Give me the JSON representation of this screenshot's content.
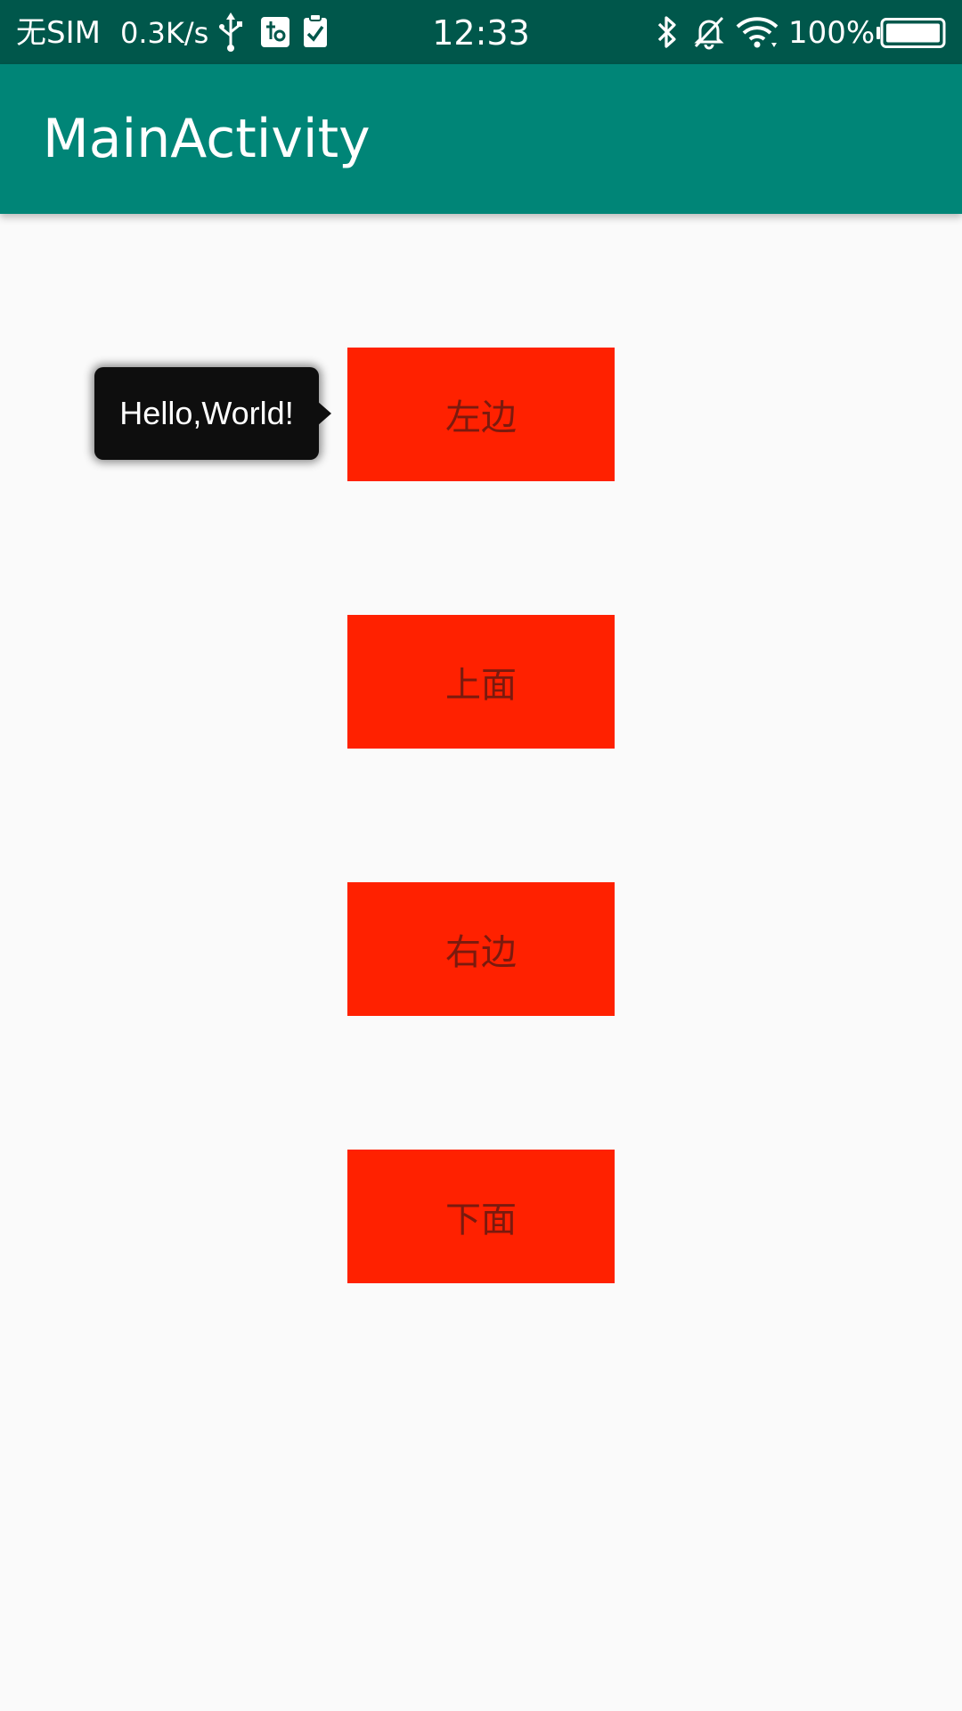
{
  "status_bar": {
    "carrier": "无SIM",
    "net_speed": "0.3K/s",
    "time": "12:33",
    "battery_percent": "100%",
    "icons": [
      "usb-icon",
      "usb-debug-icon",
      "clipboard-check-icon",
      "bluetooth-icon",
      "notifications-off-icon",
      "wifi-icon",
      "battery-icon"
    ],
    "background_color": "#00574B"
  },
  "app_bar": {
    "title": "MainActivity",
    "background_color": "#008577"
  },
  "buttons": {
    "left": "左边",
    "top": "上面",
    "right": "右边",
    "bottom": "下面",
    "color": "#FF2100"
  },
  "tooltip": {
    "text": "Hello,World!"
  }
}
